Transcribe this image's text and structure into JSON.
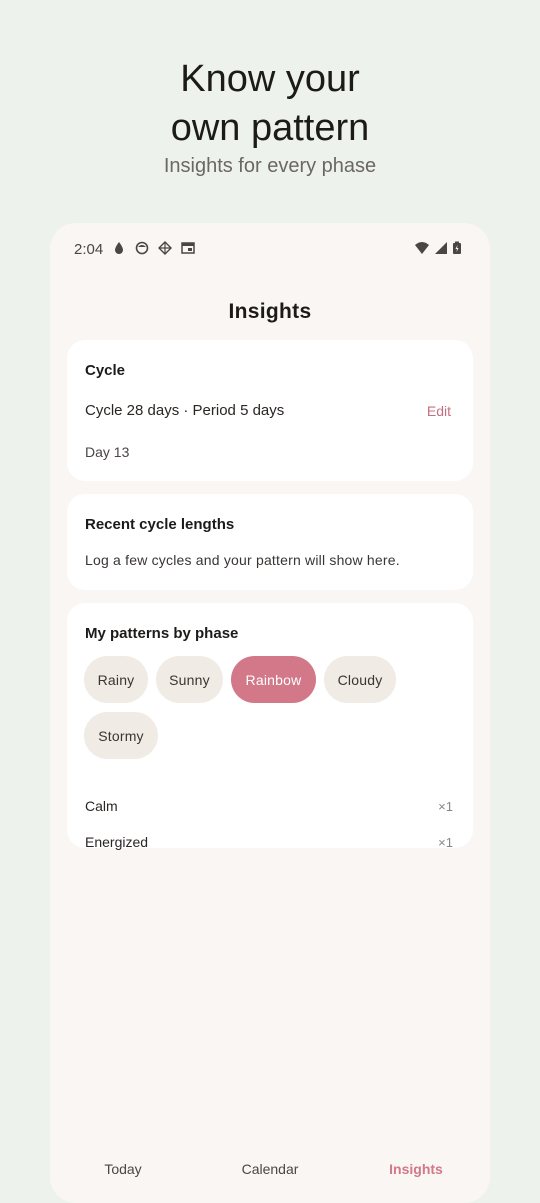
{
  "promo": {
    "title": "Know your\nown pattern",
    "subtitle": "Insights for every phase"
  },
  "status_bar": {
    "time": "2:04",
    "left_icons": [
      "drop-icon",
      "face-icon",
      "crosshair-icon",
      "calendar-widget-icon"
    ],
    "right_icons": [
      "wifi-icon",
      "signal-icon",
      "battery-icon"
    ]
  },
  "screen": {
    "title": "Insights"
  },
  "cycle_card": {
    "title": "Cycle",
    "summary": "Cycle 28 days · Period 5 days",
    "edit_label": "Edit",
    "day": "Day 13"
  },
  "recent_card": {
    "title": "Recent cycle lengths",
    "message": "Log a few cycles and your pattern will show here."
  },
  "patterns_card": {
    "title": "My patterns by phase",
    "chips": [
      {
        "label": "Rainy",
        "selected": false
      },
      {
        "label": "Sunny",
        "selected": false
      },
      {
        "label": "Rainbow",
        "selected": true
      },
      {
        "label": "Cloudy",
        "selected": false
      },
      {
        "label": "Stormy",
        "selected": false
      }
    ],
    "rows": [
      {
        "label": "Calm",
        "count": "×1"
      },
      {
        "label": "Energized",
        "count": "×1"
      }
    ]
  },
  "bottom_nav": {
    "items": [
      {
        "label": "Today",
        "active": false
      },
      {
        "label": "Calendar",
        "active": false
      },
      {
        "label": "Insights",
        "active": true
      }
    ]
  },
  "colors": {
    "accent": "#d27888",
    "background": "#eef2ec",
    "phone_surface": "#f9f6f3",
    "chip": "#f1ebe6"
  }
}
